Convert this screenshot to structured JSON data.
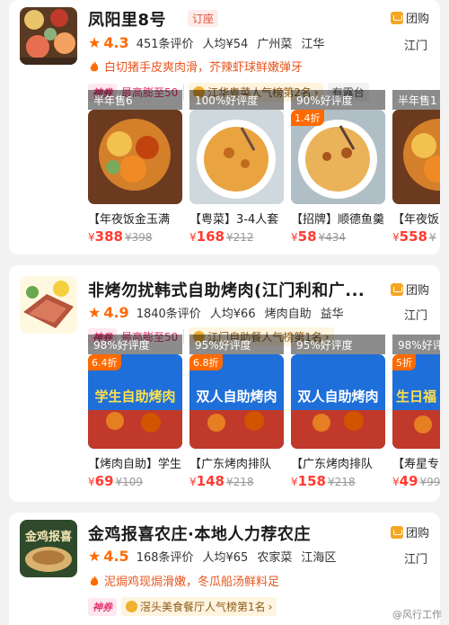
{
  "colors": {
    "accent": "#ff6a00",
    "price": "#ff3b30",
    "hot": "#e8336d"
  },
  "restaurants": [
    {
      "name": "凤阳里8号",
      "reserve": "订座",
      "groupbuy": "团购",
      "score": "4.3",
      "reviews": "451条评价",
      "avg": "人均¥54",
      "cuisine": "广州菜",
      "area": "江华",
      "city": "江门",
      "rec": "白切猪手皮爽肉滑，芥辣虾球鲜嫩弹牙",
      "shen": "神券",
      "boost": "最高膨至50",
      "rank": "江华粤菜人气榜第2名",
      "extra": "有露台",
      "deals": [
        {
          "badge": "",
          "overlay": "半年售6",
          "title": "【年夜饭金玉满",
          "price": "388",
          "orig": "¥398"
        },
        {
          "badge": "",
          "overlay": "100%好评度",
          "title": "【粤菜】3-4人套",
          "price": "168",
          "orig": "¥212"
        },
        {
          "badge": "1.4折",
          "overlay": "90%好评度",
          "title": "【招牌】顺德鱼羹",
          "price": "58",
          "orig": "¥434"
        },
        {
          "badge": "",
          "overlay": "半年售1",
          "title": "【年夜饭",
          "price": "558",
          "orig": "¥"
        }
      ]
    },
    {
      "name": "非烤勿扰韩式自助烤肉(江门利和广...",
      "groupbuy": "团购",
      "score": "4.9",
      "reviews": "1840条评价",
      "avg": "人均¥66",
      "cuisine": "烤肉自助",
      "area": "益华",
      "city": "江门",
      "shen": "神券",
      "boost": "最高膨至50",
      "rank": "江门自助餐人气榜第1名",
      "deals": [
        {
          "badge": "6.4折",
          "overlay": "98%好评度",
          "poster": "学生自助烤肉",
          "title": "【烤肉自助】学生",
          "price": "69",
          "orig": "¥109"
        },
        {
          "badge": "6.8折",
          "overlay": "95%好评度",
          "poster": "双人自助烤肉",
          "title": "【广东烤肉排队",
          "price": "148",
          "orig": "¥218"
        },
        {
          "badge": "",
          "overlay": "95%好评度",
          "poster": "双人自助烤肉",
          "title": "【广东烤肉排队",
          "price": "158",
          "orig": "¥218"
        },
        {
          "badge": "5折",
          "overlay": "98%好评",
          "poster": "生日福",
          "title": "【寿星专",
          "price": "49",
          "orig": "¥99"
        }
      ]
    },
    {
      "name": "金鸡报喜农庄·本地人力荐农庄",
      "thumb_text": "金鸡报喜",
      "groupbuy": "团购",
      "score": "4.5",
      "reviews": "168条评价",
      "avg": "人均¥65",
      "cuisine": "农家菜",
      "area": "江海区",
      "city": "江门",
      "rec": "泥焗鸡现焗滑嫩，冬瓜船汤鲜料足",
      "shen": "神券",
      "rank": "滘头美食餐厅人气榜第1名"
    }
  ],
  "watermark": "@风行工作"
}
